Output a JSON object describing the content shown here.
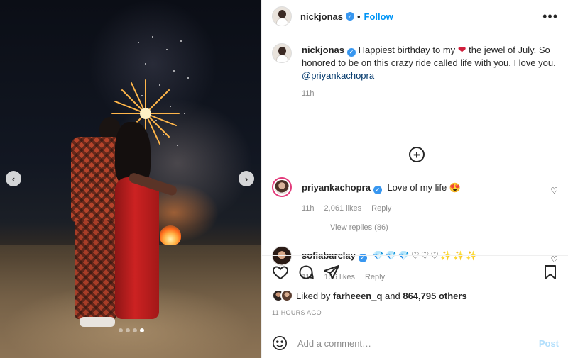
{
  "media": {
    "carousel_prev": "‹",
    "carousel_next": "›",
    "slide_count": 4,
    "active_slide": 4
  },
  "header": {
    "username": "nickjonas",
    "separator": "•",
    "follow_label": "Follow",
    "more_icon": "more-horizontal-icon"
  },
  "caption": {
    "username": "nickjonas",
    "text_before_heart": "Happiest birthday to my ",
    "heart": "❤",
    "text_after_heart": " the jewel of July. So honored to be on this crazy ride called life with you. I love you.",
    "mention": "@priyankachopra",
    "time": "11h"
  },
  "load_more": "+",
  "comments": [
    {
      "username": "priyankachopra",
      "text": "Love of my life 😍",
      "time": "11h",
      "likes": "2,061 likes",
      "reply": "Reply",
      "view_replies": "View replies (86)"
    },
    {
      "username": "sofiabarclay",
      "emojis": "💎💎💎♡♡♡✨✨✨",
      "time": "11h",
      "likes": "156 likes",
      "reply": "Reply"
    }
  ],
  "actions": {
    "like_icon": "heart-icon",
    "comment_icon": "comment-icon",
    "share_icon": "paper-plane-icon",
    "save_icon": "bookmark-icon"
  },
  "likes": {
    "prefix": "Liked by ",
    "user": "farheeen_q",
    "and": " and ",
    "others": "864,795 others"
  },
  "timestamp": "11 HOURS AGO",
  "add_comment": {
    "placeholder": "Add a comment…",
    "post_label": "Post"
  },
  "colors": {
    "accent": "#0095f6",
    "verified": "#3897f0",
    "text": "#262626",
    "muted": "#8e8e8e",
    "post_disabled": "#b2dffc"
  }
}
